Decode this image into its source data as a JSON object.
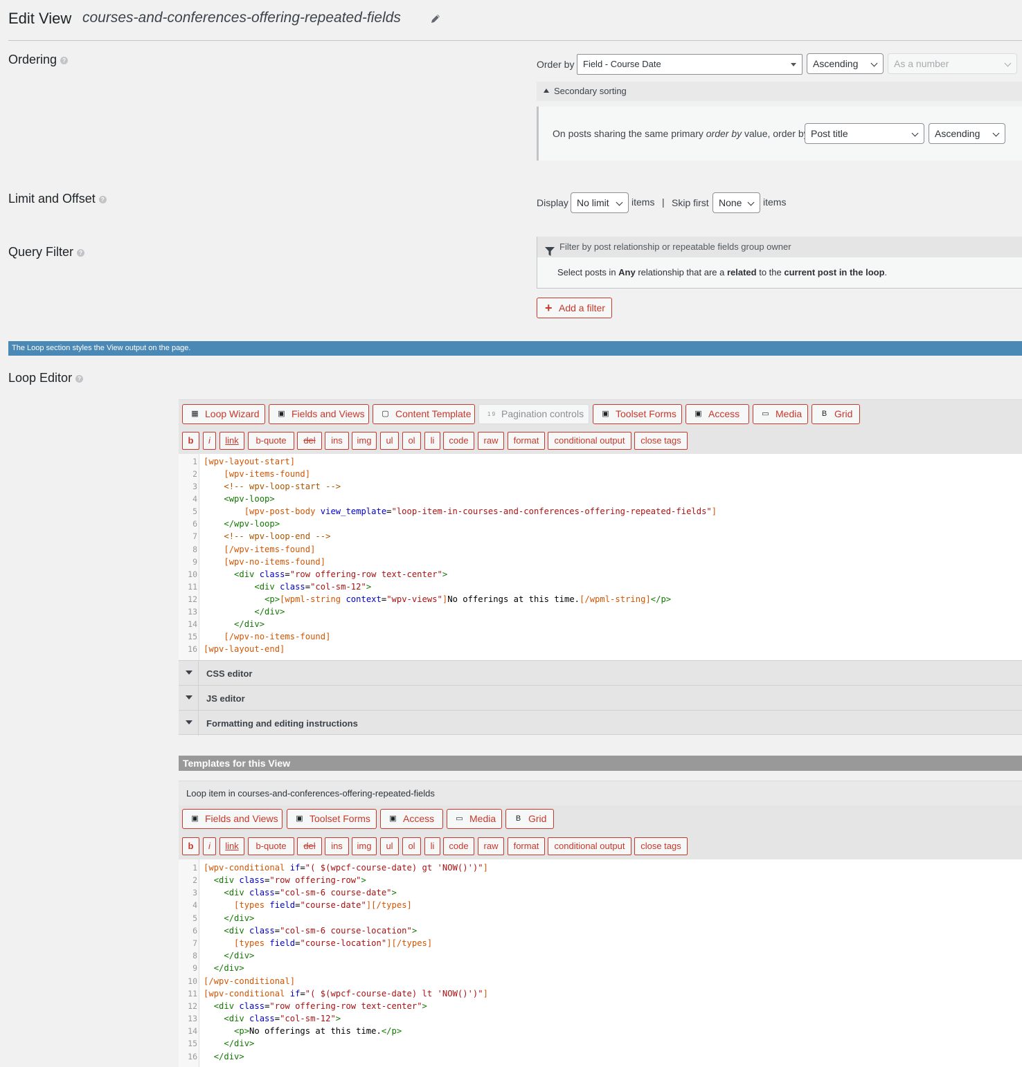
{
  "header": {
    "title": "Edit View",
    "view_name": "courses-and-conferences-offering-repeated-fields"
  },
  "ordering": {
    "label": "Ordering",
    "order_by_label": "Order by",
    "order_by_value": "Field - Course Date",
    "direction": "Ascending",
    "as_type": "As a number",
    "secondary_toggle": "Secondary sorting",
    "secondary_text_a": "On posts sharing the same primary ",
    "secondary_text_em": "order by",
    "secondary_text_b": " value, order by",
    "secondary_field": "Post title",
    "secondary_direction": "Ascending"
  },
  "limit": {
    "label": "Limit and Offset",
    "display_label": "Display",
    "display_value": "No limit",
    "items1": "items",
    "pipe": "|",
    "skip_label": "Skip first",
    "skip_value": "None",
    "items2": "items"
  },
  "query_filter": {
    "label": "Query Filter",
    "filter_title": "Filter by post relationship or repeatable fields group owner",
    "desc_1": "Select posts in ",
    "desc_2": "Any",
    "desc_3": " relationship that are a ",
    "desc_4": "related",
    "desc_5": " to the ",
    "desc_6": "current post in the loop",
    "desc_7": ".",
    "add_filter": "Add a filter"
  },
  "info_bar": "The Loop section styles the View output on the page.",
  "loop_editor": {
    "label": "Loop Editor",
    "toolbar": [
      "Loop Wizard",
      "Fields and Views",
      "Content Template",
      "Pagination controls",
      "Toolset Forms",
      "Access",
      "Media",
      "Grid"
    ],
    "quicktags": [
      "b",
      "i",
      "link",
      "b-quote",
      "del",
      "ins",
      "img",
      "ul",
      "ol",
      "li",
      "code",
      "raw",
      "format",
      "conditional output",
      "close tags"
    ],
    "accordions": [
      "CSS editor",
      "JS editor",
      "Formatting and editing instructions"
    ]
  },
  "templates": {
    "bar_title": "Templates for this View",
    "item_title": "Loop item in courses-and-conferences-offering-repeated-fields",
    "toolbar": [
      "Fields and Views",
      "Toolset Forms",
      "Access",
      "Media",
      "Grid"
    ],
    "quicktags": [
      "b",
      "i",
      "link",
      "b-quote",
      "del",
      "ins",
      "img",
      "ul",
      "ol",
      "li",
      "code",
      "raw",
      "format",
      "conditional output",
      "close tags"
    ]
  },
  "icons": {
    "pencil": "pencil-icon",
    "funnel": "funnel-icon",
    "plus": "plus-icon",
    "grid": "grid-icon",
    "lock": "lock-icon",
    "media": "media-icon",
    "clipboard": "clipboard-icon"
  },
  "colors": {
    "accent": "#c9372c",
    "info_bar": "#4a88b5",
    "template_bar": "#999999"
  }
}
